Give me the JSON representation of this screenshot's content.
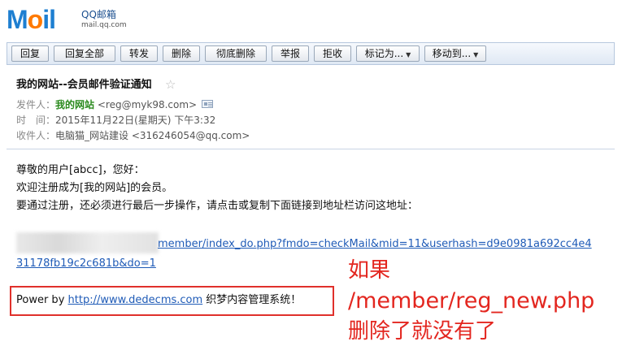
{
  "logo": {
    "main_prefix": "M",
    "main_o": "o",
    "main_suffix": "il",
    "sub": "QQ邮箱",
    "domain": "mail.qq.com"
  },
  "toolbar": {
    "reply": "回复",
    "reply_all": "回复全部",
    "forward": "转发",
    "delete": "删除",
    "delete_permanently": "彻底删除",
    "report": "举报",
    "reject": "拒收",
    "mark_as": "标记为...",
    "move_to": "移动到...",
    "dropdown_glyph": "▼"
  },
  "email": {
    "subject": "我的网站--会员邮件验证通知",
    "star": "☆",
    "sender_label": "发件人：",
    "sender_name": "我的网站",
    "sender_email": "<reg@myk98.com>",
    "time_label": "时　间：",
    "time_value": "2015年11月22日(星期天) 下午3:32",
    "recipient_label": "收件人：",
    "recipient_value": "电脑猫_网站建设 <316246054@qq.com>"
  },
  "body": {
    "greeting": "尊敬的用户[abcc]，您好：",
    "welcome": "欢迎注册成为[我的网站]的会员。",
    "instruction": "要通过注册，还必须进行最后一步操作，请点击或复制下面链接到地址栏访问这地址：",
    "link_part1": "member/index_do.php?fmdo=checkMail&mid=11&userhash=d9e0981a692cc4e4",
    "link_part2": "31178fb19c2c681b&do=1",
    "power_prefix": "Power by ",
    "power_link": "http://www.dedecms.com",
    "power_suffix": " 织梦内容管理系统！"
  },
  "annotation": {
    "line1": "如果",
    "line2": "/member/reg_new.php",
    "line3": "删除了就没有了"
  },
  "colors": {
    "accent": "#1e7fd1",
    "annotation": "#e3261f",
    "sender": "#2a8a1d",
    "link": "#1f5bb7"
  }
}
